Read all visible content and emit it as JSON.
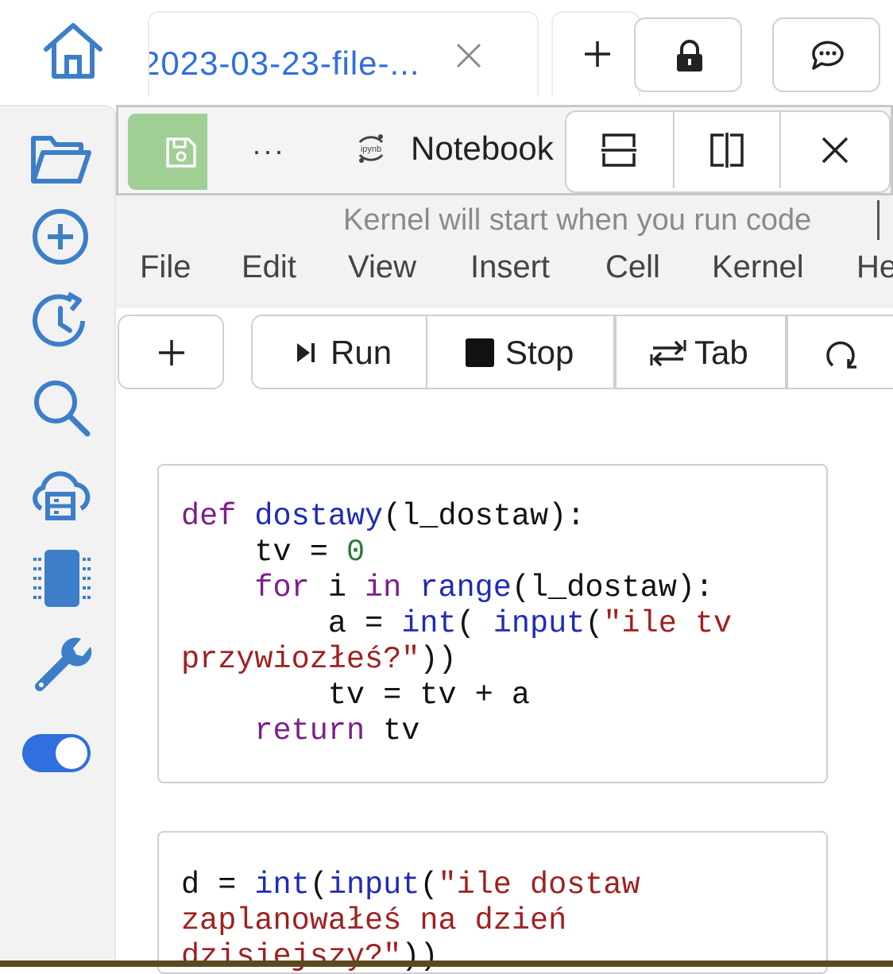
{
  "tabs": {
    "active_title": "2023-03-23-file-...",
    "close_icon": "close-icon",
    "new_tab_icon": "plus-icon"
  },
  "top_actions": [
    {
      "name": "lock",
      "icon": "lock-icon"
    },
    {
      "name": "chat",
      "icon": "chat-icon"
    }
  ],
  "sidebar": {
    "items": [
      {
        "icon": "folder-open-icon"
      },
      {
        "icon": "add-circle-icon"
      },
      {
        "icon": "history-icon"
      },
      {
        "icon": "search-icon"
      },
      {
        "icon": "cloud-storage-icon"
      },
      {
        "icon": "chip-icon"
      },
      {
        "icon": "wrench-icon"
      }
    ],
    "toggle_on": true,
    "accent": "#2f6fde"
  },
  "notebook_toolbar": {
    "save_icon": "save-icon",
    "more_label": "···",
    "kernel_icon": "ipynb",
    "label": "Notebook",
    "view_buttons": [
      "split-horizontal-icon",
      "split-vertical-icon",
      "close-icon"
    ]
  },
  "kernel_status": "Kernel will start when you run code",
  "menu": [
    "File",
    "Edit",
    "View",
    "Insert",
    "Cell",
    "Kernel",
    "He"
  ],
  "run_toolbar": {
    "add_icon": "plus-icon",
    "run_label": "Run",
    "stop_label": "Stop",
    "tab_label": "Tab",
    "restart_icon": "restart-icon"
  },
  "cells": [
    {
      "lines": [
        "def dostawy(l_dostaw):",
        "    tv = 0",
        "    for i in range(l_dostaw):",
        "        a = int( input(\"ile tv",
        "przywiozłeś?\"))",
        "        tv = tv + a",
        "    return tv"
      ]
    },
    {
      "lines": [
        "d = int(input(\"ile dostaw",
        "zaplanowałeś na dzień",
        "dzisiejszy?\"))"
      ]
    }
  ],
  "colors": {
    "save_button": "#9fcf95",
    "keyword": "#7c1f8a",
    "builtin": "#1f2bb8",
    "string": "#a02020",
    "number": "#2a7a3a"
  }
}
